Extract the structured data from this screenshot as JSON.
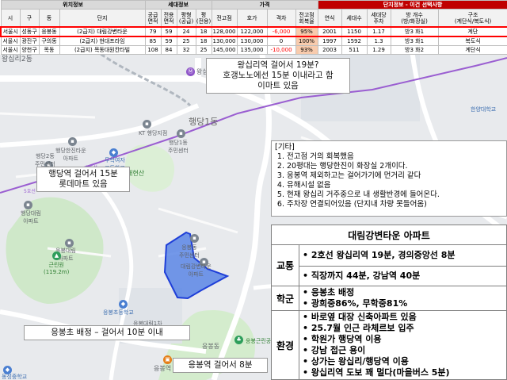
{
  "table": {
    "groups": {
      "location": "위치정보",
      "household": "세대정보",
      "price": "가격",
      "complex": "단지정보 - 이건 선택사항"
    },
    "columns": [
      "시",
      "구",
      "동",
      "단지",
      "공급\n면적",
      "전용\n면적",
      "평형\n(공급)",
      "평\n(전용)",
      "전고점",
      "호가",
      "격차",
      "전고점\n회복율",
      "연식",
      "세대수",
      "세대당\n주차",
      "방 개수\n(방/화장실)",
      "구조\n(계단식/복도식)"
    ],
    "rows": [
      {
        "si": "서울시",
        "gu": "성동구",
        "dong": "응봉동",
        "name": "(2급지) 대림강변타운",
        "supply": "79",
        "exclusive": "59",
        "pyeong_supply": "24",
        "pyeong_excl": "18",
        "peak": "128,000",
        "ask": "122,000",
        "gap": "-6,000",
        "recovery": "95%",
        "year": "2001",
        "households": "1150",
        "parking": "1.17",
        "rooms": "방3 화1",
        "structure": "계단"
      },
      {
        "si": "서울시",
        "gu": "광진구",
        "dong": "구의동",
        "name": "(2급지) 현대프라임",
        "supply": "85",
        "exclusive": "59",
        "pyeong_supply": "25",
        "pyeong_excl": "18",
        "peak": "130,000",
        "ask": "130,000",
        "gap": "0",
        "recovery": "100%",
        "year": "1997",
        "households": "1592",
        "parking": "1.3",
        "rooms": "방3 화1",
        "structure": "복도식"
      },
      {
        "si": "서울시",
        "gu": "양천구",
        "dong": "목동",
        "name": "(2급지) 목동대원칸타빌",
        "supply": "108",
        "exclusive": "84",
        "pyeong_supply": "32",
        "pyeong_excl": "25",
        "peak": "145,000",
        "ask": "135,000",
        "gap": "-10,000",
        "recovery": "93%",
        "year": "2003",
        "households": "511",
        "parking": "1.29",
        "rooms": "방3 화2",
        "structure": "계단식"
      }
    ]
  },
  "map": {
    "labels": {
      "wangsimni2": "왕십리2동",
      "haengdang1": "행당1동",
      "haengdang1_center": "행당1동\n주민센터",
      "haengdang2_center": "행당2동\n주민센터",
      "kt_tower": "KT 행당지점",
      "haengdang_hanjin": "행당한진타운\n아파트",
      "haengdang_daerim": "행당대림\n아파트",
      "muhak_high": "무학여자\n고등학교",
      "eungbong_shin": "응봉대림\n아파트",
      "daehyeon_san": "대현산",
      "hanyang": "한양대학교",
      "seungbong_center": "응봉동\n주민센터",
      "eungbong_elem": "응봉초등학교",
      "daerim_gangbyeon": "대림강변타운\n아파트",
      "eungbong_park": "응봉근린공원",
      "green_park": "근린원\n(119.2m)",
      "daerim_1st": "응봉대림1차\n아파트",
      "eungbong_station": "응봉역",
      "eungbong_label": "응봉동",
      "dongseong": "동성중학교",
      "wangsimni_station": "왕십리역",
      "road_label_1": "5호선",
      "road_label_2": "5호선"
    },
    "callouts": {
      "wangsimni_walk_line1": "왕십리역 걸어서 19분?",
      "wangsimni_walk_line2": "호갱노노에선 15분 이내라고 함",
      "wangsimni_walk_line3": "이마트 있음",
      "haengdang_walk_line1": "행당역 걸어서 15분",
      "haengdang_walk_line2": "롯데마트 있음",
      "eungbong_school": "응봉초 배정 – 걸어서 10분 이내",
      "eungbong_station_walk": "응봉역 걸어서 8분"
    }
  },
  "memo": {
    "title": "[기타]",
    "items": [
      "전고점 거의 회복했음",
      "20평대는 행당한진이 화장실 2개이다.",
      "응봉역 제외하고는 걸어가기에 먼거리 같다",
      "유해시설 없음",
      "현재 왕십리 거주중으로 내 생활반경에 들어온다.",
      "주차장 연결되어있음 (단지내 차량 못들어옴)"
    ]
  },
  "summary": {
    "title": "대림강변타운 아파트",
    "transport": {
      "label": "교통",
      "items": [
        "• 2호선 왕십리역 19분, 경의중앙선 8분",
        "• 직장까지 44분, 강남역 40분"
      ]
    },
    "school": {
      "label": "학군",
      "items": [
        "• 응봉초 배정",
        "• 광희중86%, 무학중81%"
      ]
    },
    "environment": {
      "label": "환경",
      "items": [
        "• 바로옆 대장 신축아파트 있음",
        "• 25.7월 인근 라체르보 입주",
        "• 학원가 행당역 이용",
        "• 강남 접근 용이",
        "• 상가는 왕십리/행당역 이용",
        "• 왕십리역 도보 꽤 멀다(마을버스 5분)"
      ]
    }
  },
  "colors": {
    "highlight_border": "#ff0000",
    "negative": "#ff0000",
    "header_accent": "#c00000",
    "polygon_stroke": "#1f3fd8",
    "polygon_fill": "#5b86e5"
  }
}
